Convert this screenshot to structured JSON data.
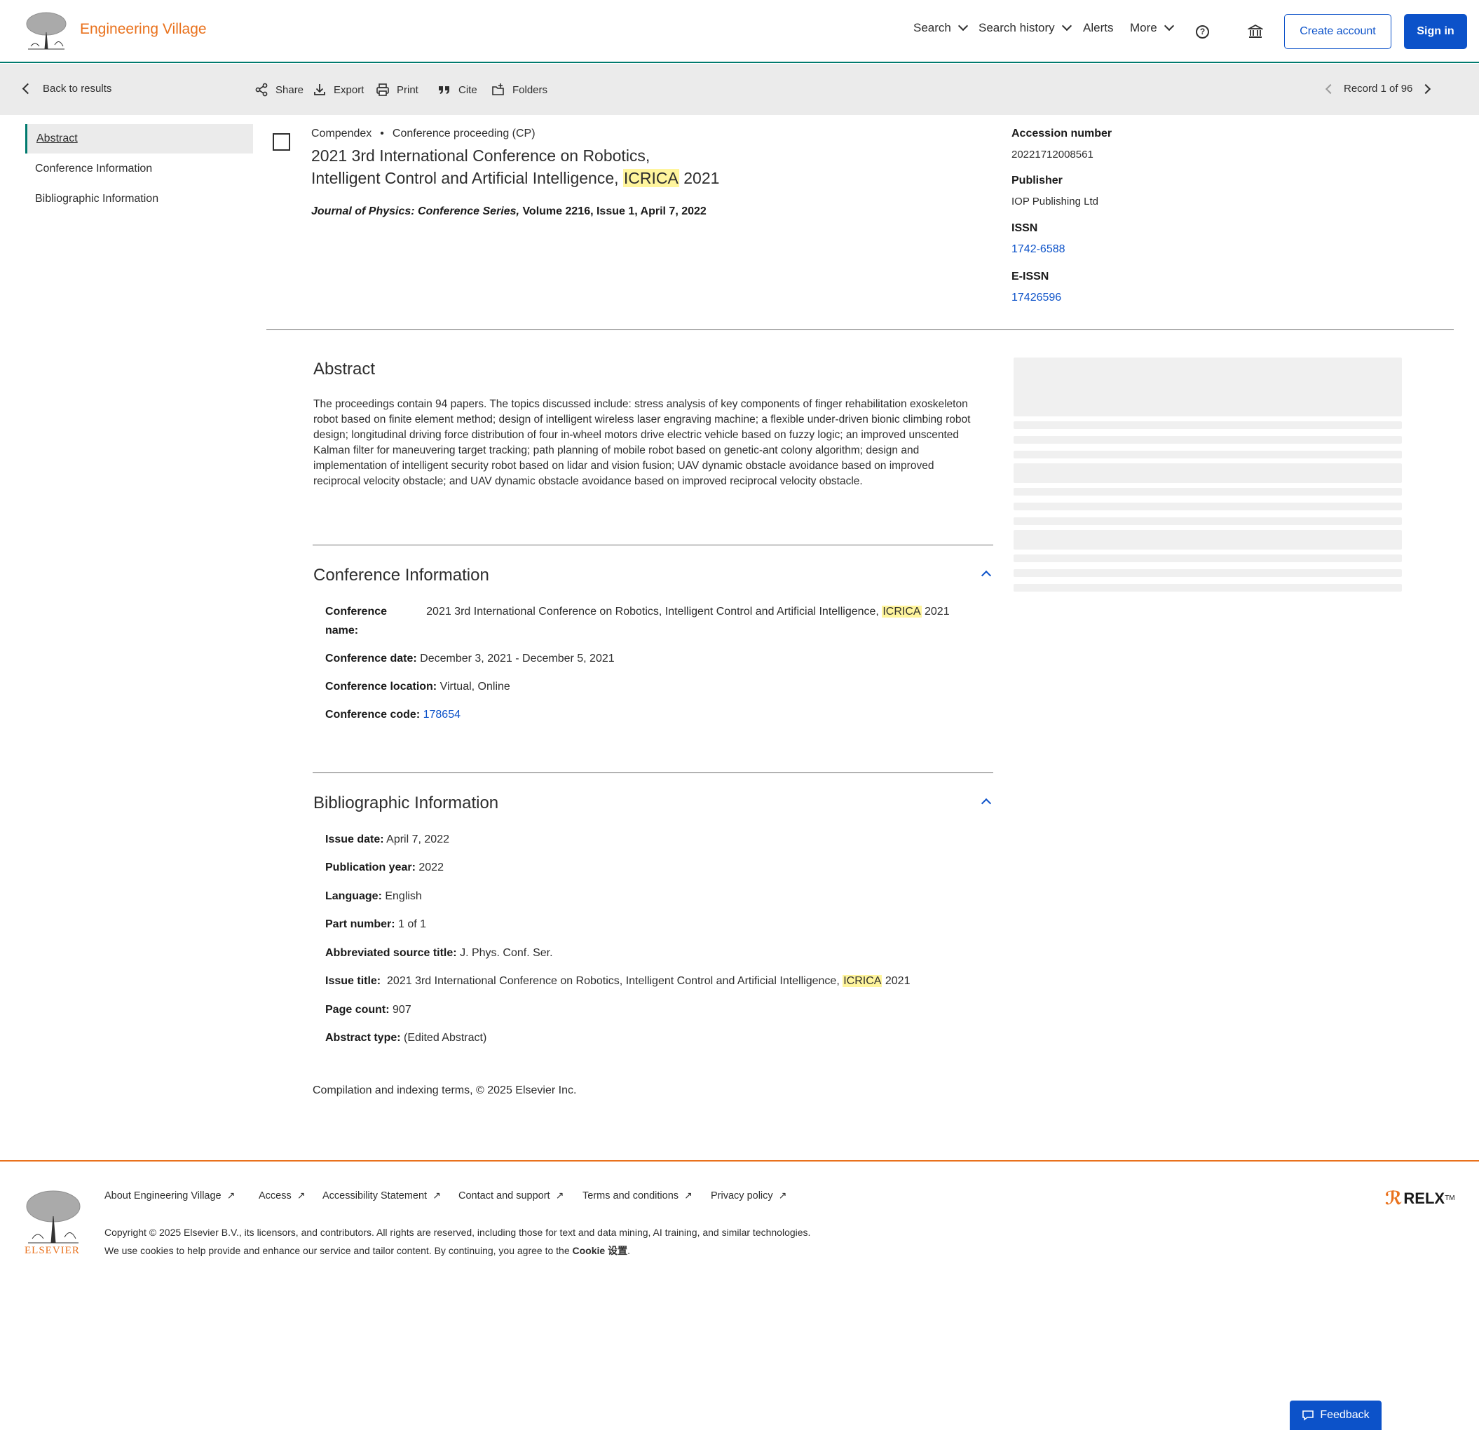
{
  "header": {
    "brand": "Engineering Village",
    "nav": [
      "Search",
      "Search history",
      "Alerts",
      "More"
    ],
    "create_account": "Create account",
    "sign_in": "Sign in"
  },
  "toolbar": {
    "back": "Back to results",
    "share": "Share",
    "export": "Export",
    "print": "Print",
    "cite": "Cite",
    "folders": "Folders",
    "record": "Record 1 of 96"
  },
  "sidebar": {
    "items": [
      {
        "label": "Abstract",
        "active": true
      },
      {
        "label": "Conference Information",
        "active": false
      },
      {
        "label": "Bibliographic Information",
        "active": false
      }
    ]
  },
  "record": {
    "database": "Compendex",
    "doc_type": "Conference proceeding (CP)",
    "title_line1": "2021 3rd International Conference on Robotics,",
    "title_line2_pre": "Intelligent Control and Artificial Intelligence, ",
    "title_highlight": "ICRICA",
    "title_line2_post": " 2021",
    "journal_italic": "Journal of Physics: Conference Series,",
    "journal_rest": " Volume 2216, Issue 1, April 7, 2022"
  },
  "right_meta": {
    "accession_label": "Accession number",
    "accession_value": "20221712008561",
    "publisher_label": "Publisher",
    "publisher_value": "IOP Publishing Ltd",
    "issn_label": "ISSN",
    "issn_value": "1742-6588",
    "eissn_label": "E-ISSN",
    "eissn_value": "17426596"
  },
  "abstract": {
    "heading": "Abstract",
    "text": "The proceedings contain 94 papers. The topics discussed include: stress analysis of key components of finger rehabilitation exoskeleton robot based on finite element method; design of intelligent wireless laser engraving machine; a flexible under-driven bionic climbing robot design; longitudinal driving force distribution of four in-wheel motors drive electric vehicle based on fuzzy logic; an improved unscented Kalman filter for maneuvering target tracking; path planning of mobile robot based on genetic-ant colony algorithm; design and implementation of intelligent security robot based on lidar and vision fusion; UAV dynamic obstacle avoidance based on improved reciprocal velocity obstacle; and UAV dynamic obstacle avoidance based on improved reciprocal velocity obstacle."
  },
  "conference": {
    "heading": "Conference Information",
    "name_label": "Conference name:",
    "name_pre": "2021 3rd International Conference on Robotics, Intelligent Control and Artificial Intelligence, ",
    "name_highlight": "ICRICA",
    "name_post": " 2021",
    "date_label": "Conference date:",
    "date_value": "December 3, 2021 - December 5, 2021",
    "location_label": "Conference location:",
    "location_value": "Virtual, Online",
    "code_label": "Conference code:",
    "code_value": "178654"
  },
  "bibliographic": {
    "heading": "Bibliographic Information",
    "issue_date_label": "Issue date:",
    "issue_date_value": "April 7, 2022",
    "pub_year_label": "Publication year:",
    "pub_year_value": "2022",
    "language_label": "Language:",
    "language_value": "English",
    "part_label": "Part number:",
    "part_value": "1 of 1",
    "abbr_label": "Abbreviated source title:",
    "abbr_value": "J. Phys. Conf. Ser.",
    "issue_title_label": "Issue title:",
    "issue_title_pre": "2021 3rd International Conference on Robotics, Intelligent Control and Artificial Intelligence, ",
    "issue_title_highlight": "ICRICA",
    "issue_title_post": " 2021",
    "page_count_label": "Page count:",
    "page_count_value": "907",
    "abstract_type_label": "Abstract type:",
    "abstract_type_value": "(Edited Abstract)"
  },
  "compilation": "Compilation and indexing terms, © 2025 Elsevier Inc.",
  "footer": {
    "links": [
      "About Engineering Village",
      "Access",
      "Accessibility Statement",
      "Contact and support",
      "Terms and conditions",
      "Privacy policy"
    ],
    "copyright": "Copyright © 2025 Elsevier B.V., its licensors, and contributors. All rights are reserved, including those for text and data mining, AI training, and similar technologies.",
    "cookie_pre": "We use cookies to help provide and enhance our service and tailor content. By continuing, you agree to the ",
    "cookie_link": "Cookie 设置",
    "cookie_post": ".",
    "elsevier_word": "ELSEVIER",
    "relx": "RELX",
    "relx_tm": "TM"
  },
  "feedback": "Feedback",
  "colors": {
    "brand_orange": "#e9711c",
    "link_blue": "#0c52c9",
    "teal_accent": "#007a6e",
    "highlight": "#fff59d"
  }
}
